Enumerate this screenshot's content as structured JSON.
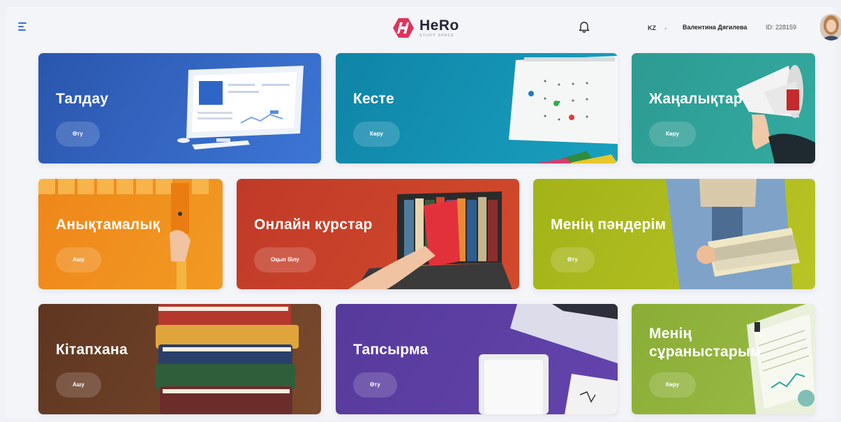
{
  "header": {
    "logo_name": "HeRo",
    "logo_sub": "STUDY SPACE",
    "lang": "KZ",
    "lang_chevron": "⌄",
    "user_name": "Валентина Дягилева",
    "user_id": "ID: 228159",
    "icons": [
      "menu-icon",
      "bell-icon",
      "avatar"
    ]
  },
  "cards": [
    {
      "title": "Талдау",
      "button": "Өту",
      "color": "#2f5fb8"
    },
    {
      "title": "Кесте",
      "button": "Көру",
      "color": "#1487ad"
    },
    {
      "title": "Жаңалықтар",
      "button": "Көру",
      "color": "#2e9c93"
    },
    {
      "title": "Анықтамалық",
      "button": "Ашу",
      "color": "#ef8a1c"
    },
    {
      "title": "Онлайн курстар",
      "button": "Оқып білу",
      "color": "#c4402a"
    },
    {
      "title": "Менің пәндерім",
      "button": "Өту",
      "color": "#a3b41a"
    },
    {
      "title": "Кітапхана",
      "button": "Ашу",
      "color": "#6a3f24"
    },
    {
      "title": "Тапсырма",
      "button": "Өту",
      "color": "#5c3fa0"
    },
    {
      "title": "Менің сұраныстарым",
      "button": "Көру",
      "color": "#8cb33d"
    }
  ]
}
